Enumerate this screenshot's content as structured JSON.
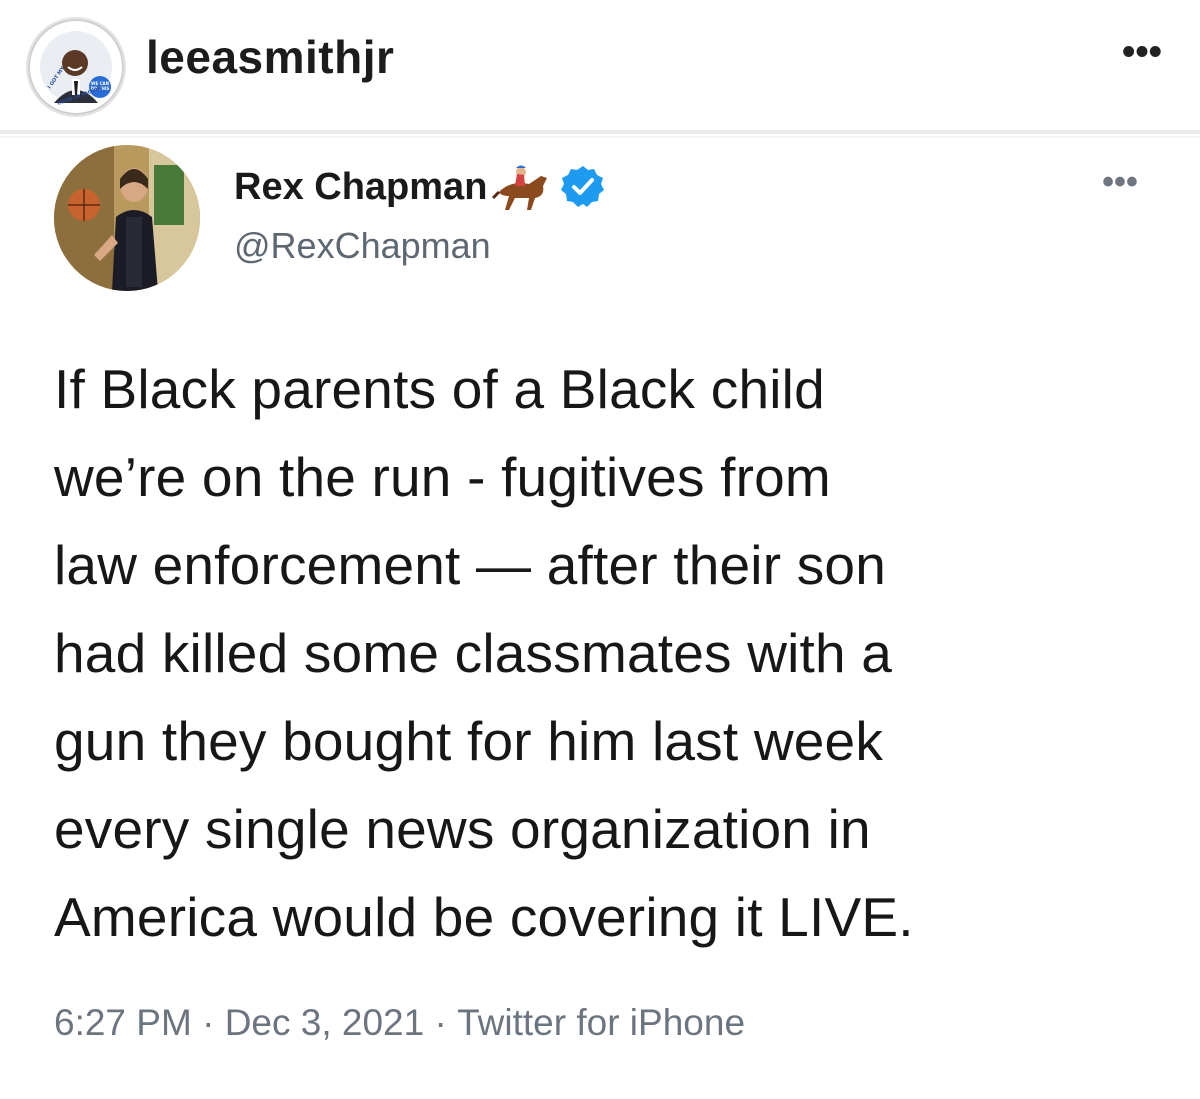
{
  "instagram": {
    "username": "leeasmithjr",
    "avatar_badge_text": "I GOT MY COVID-19 VACCINE",
    "avatar_badge_inner": "WE CAN DO THIS",
    "more_icon": "more-horizontal-icon",
    "more_label": "•••"
  },
  "tweet": {
    "display_name": "Rex Chapman",
    "name_emoji": "horse-racing-emoji",
    "verified_icon": "verified-badge-icon",
    "handle": "@RexChapman",
    "more_label": "•••",
    "text": "If Black parents of a Black child\nwe’re on the run - fugitives from\nlaw enforcement — after their son\nhad killed some classmates with a\ngun they bought for him last week\nevery single news organization in\nAmerica would be covering it LIVE.",
    "time": "6:27 PM",
    "date": "Dec 3, 2021",
    "source": "Twitter for iPhone",
    "separator": "·"
  },
  "colors": {
    "verified_blue": "#1d9bf0",
    "handle_gray": "#5d6873",
    "text_black": "#171717"
  }
}
